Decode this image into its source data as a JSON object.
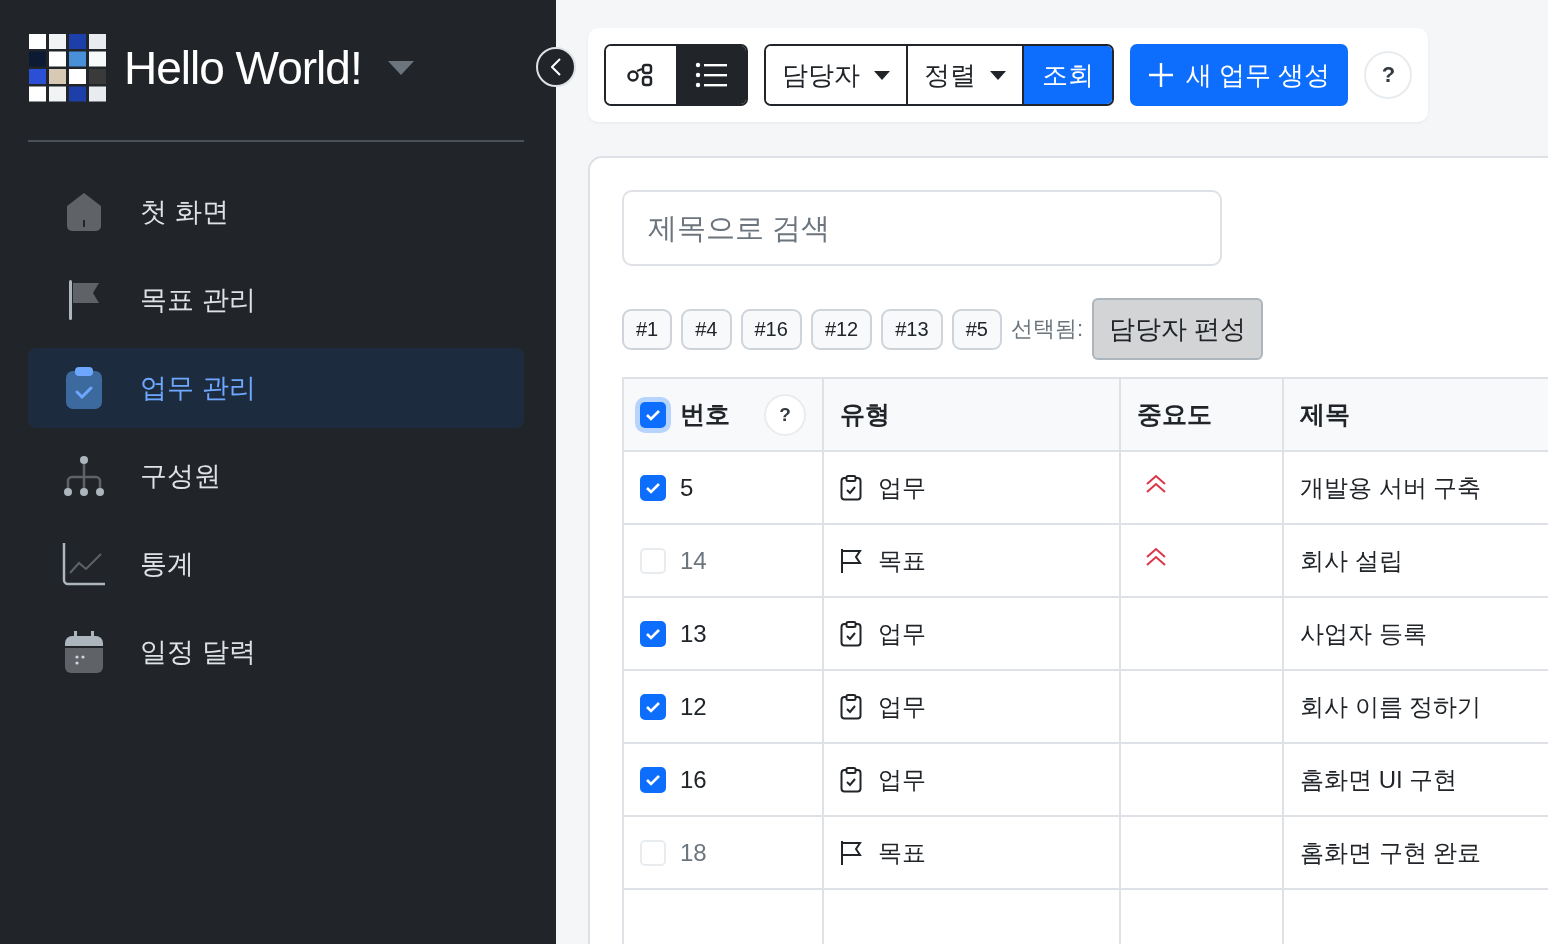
{
  "brand": {
    "title": "Hello World!"
  },
  "sidebar": {
    "items": [
      {
        "label": "첫 화면",
        "selected": false
      },
      {
        "label": "목표 관리",
        "selected": false
      },
      {
        "label": "업무 관리",
        "selected": true
      },
      {
        "label": "구성원",
        "selected": false
      },
      {
        "label": "통계",
        "selected": false
      },
      {
        "label": "일정 달력",
        "selected": false
      }
    ]
  },
  "toolbar": {
    "view_toggle": [
      {
        "selected": false
      },
      {
        "selected": true
      }
    ],
    "filters": [
      {
        "label": "담당자"
      },
      {
        "label": "정렬"
      }
    ],
    "search_button": "조회",
    "create_button": "새 업무 생성",
    "help": "?"
  },
  "search": {
    "placeholder": "제목으로 검색"
  },
  "selection": {
    "tags": [
      "#1",
      "#4",
      "#16",
      "#12",
      "#13",
      "#5"
    ],
    "label": "선택됨:",
    "assign_button": "담당자 편성"
  },
  "table": {
    "select_all": {
      "checked": true
    },
    "help": "?",
    "columns": [
      {
        "label": "번호"
      },
      {
        "label": "유형"
      },
      {
        "label": "중요도"
      },
      {
        "label": "제목"
      }
    ],
    "rows": [
      {
        "checked": true,
        "number": "5",
        "type": {
          "kind": "task",
          "label": "업무"
        },
        "high_priority": true,
        "title": "개발용 서버 구축"
      },
      {
        "checked": false,
        "number": "14",
        "type": {
          "kind": "goal",
          "label": "목표"
        },
        "high_priority": true,
        "title": "회사 설립"
      },
      {
        "checked": true,
        "number": "13",
        "type": {
          "kind": "task",
          "label": "업무"
        },
        "high_priority": false,
        "title": "사업자 등록"
      },
      {
        "checked": true,
        "number": "12",
        "type": {
          "kind": "task",
          "label": "업무"
        },
        "high_priority": false,
        "title": "회사 이름 정하기"
      },
      {
        "checked": true,
        "number": "16",
        "type": {
          "kind": "task",
          "label": "업무"
        },
        "high_priority": false,
        "title": "홈화면 UI 구현"
      },
      {
        "checked": false,
        "number": "18",
        "type": {
          "kind": "goal",
          "label": "목표"
        },
        "high_priority": false,
        "title": "홈화면 구현 완료"
      }
    ]
  }
}
